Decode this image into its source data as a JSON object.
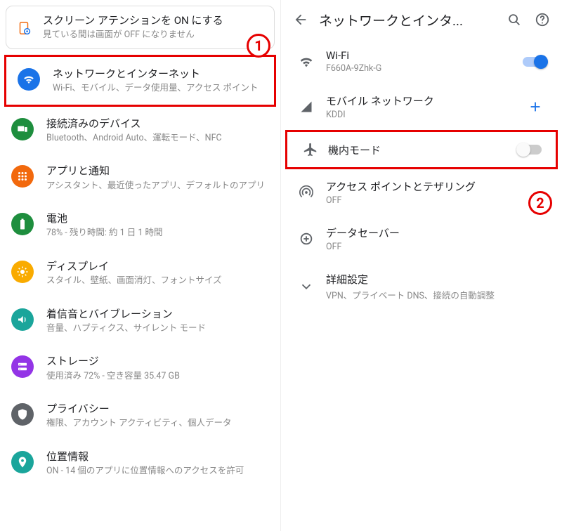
{
  "left": {
    "suggestion": {
      "title": "スクリーン アテンションを ON にする",
      "subtitle": "見ている間は画面が OFF になりません"
    },
    "items": [
      {
        "icon": "wifi",
        "color": "#1a73e8",
        "title": "ネットワークとインターネット",
        "subtitle": "Wi-Fi、モバイル、データ使用量、アクセス ポイント"
      },
      {
        "icon": "devices",
        "color": "#1e8e3e",
        "title": "接続済みのデバイス",
        "subtitle": "Bluetooth、Android Auto、運転モード、NFC"
      },
      {
        "icon": "apps",
        "color": "#f2690d",
        "title": "アプリと通知",
        "subtitle": "アシスタント、最近使ったアプリ、デフォルトのアプリ"
      },
      {
        "icon": "battery",
        "color": "#1e8e3e",
        "title": "電池",
        "subtitle": "78% - 残り時間: 約 1 日 1 時間"
      },
      {
        "icon": "display",
        "color": "#f9ab00",
        "title": "ディスプレイ",
        "subtitle": "スタイル、壁紙、画面消灯、フォントサイズ"
      },
      {
        "icon": "sound",
        "color": "#1aa59b",
        "title": "着信音とバイブレーション",
        "subtitle": "音量、ハプティクス、サイレント モード"
      },
      {
        "icon": "storage",
        "color": "#9334e6",
        "title": "ストレージ",
        "subtitle": "使用済み 72% - 空き容量 35.47 GB"
      },
      {
        "icon": "privacy",
        "color": "#5f6368",
        "title": "プライバシー",
        "subtitle": "権限、アカウント アクティビティ、個人データ"
      },
      {
        "icon": "location",
        "color": "#1aa59b",
        "title": "位置情報",
        "subtitle": "ON - 14 個のアプリに位置情報へのアクセスを許可"
      }
    ]
  },
  "right": {
    "header_title": "ネットワークとインタ...",
    "items": [
      {
        "icon_name": "wifi-icon",
        "title": "Wi-Fi",
        "subtitle": "F660A-9Zhk-G",
        "trailing": "switch-on"
      },
      {
        "icon_name": "cellular-icon",
        "title": "モバイル ネットワーク",
        "subtitle": "KDDI",
        "trailing": "plus"
      },
      {
        "icon_name": "airplane-icon",
        "title": "機内モード",
        "subtitle": "",
        "trailing": "switch-off"
      },
      {
        "icon_name": "hotspot-icon",
        "title": "アクセス ポイントとテザリング",
        "subtitle": "OFF",
        "trailing": ""
      },
      {
        "icon_name": "datasaver-icon",
        "title": "データセーバー",
        "subtitle": "OFF",
        "trailing": ""
      },
      {
        "icon_name": "expand-icon",
        "title": "詳細設定",
        "subtitle": "VPN、プライベート DNS、接続の自動調整",
        "trailing": ""
      }
    ]
  },
  "annotations": {
    "badge1": "1",
    "badge2": "2"
  }
}
